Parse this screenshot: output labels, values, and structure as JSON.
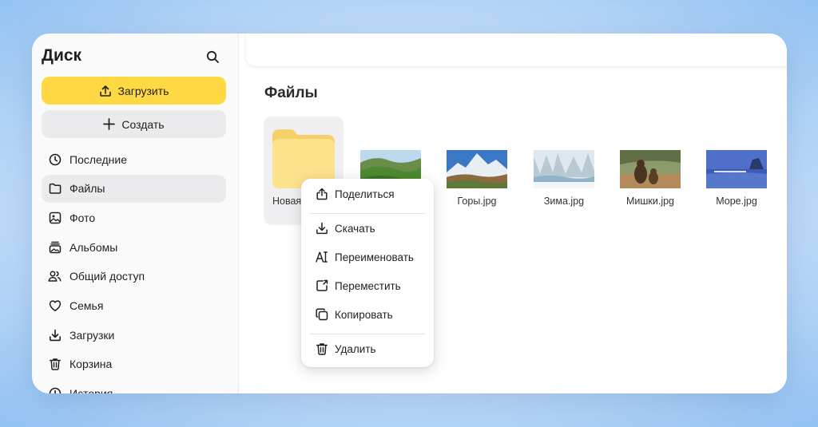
{
  "sidebar": {
    "logo": "Диск",
    "upload_label": "Загрузить",
    "create_label": "Создать",
    "items": [
      {
        "label": "Последние",
        "icon": "clock-icon"
      },
      {
        "label": "Файлы",
        "icon": "folder-icon",
        "active": true
      },
      {
        "label": "Фото",
        "icon": "photo-icon"
      },
      {
        "label": "Альбомы",
        "icon": "albums-icon"
      },
      {
        "label": "Общий доступ",
        "icon": "shared-icon"
      },
      {
        "label": "Семья",
        "icon": "family-heart-icon"
      },
      {
        "label": "Загрузки",
        "icon": "download-icon"
      },
      {
        "label": "Корзина",
        "icon": "trash-icon"
      },
      {
        "label": "История",
        "icon": "history-icon"
      }
    ]
  },
  "main": {
    "title": "Файлы",
    "files": [
      {
        "name": "Новая",
        "type": "folder",
        "selected": true
      },
      {
        "name": "",
        "type": "image",
        "thumb": "green-hills"
      },
      {
        "name": "Горы.jpg",
        "type": "image",
        "thumb": "snowy-mountains"
      },
      {
        "name": "Зима.jpg",
        "type": "image",
        "thumb": "winter-river"
      },
      {
        "name": "Мишки.jpg",
        "type": "image",
        "thumb": "bears"
      },
      {
        "name": "Море.jpg",
        "type": "image",
        "thumb": "sea-pier"
      }
    ]
  },
  "context_menu": {
    "items": [
      {
        "label": "Поделиться",
        "icon": "share-icon"
      },
      {
        "label": "Скачать",
        "icon": "download-icon"
      },
      {
        "label": "Переименовать",
        "icon": "rename-icon"
      },
      {
        "label": "Переместить",
        "icon": "move-icon"
      },
      {
        "label": "Копировать",
        "icon": "copy-icon"
      },
      {
        "label": "Удалить",
        "icon": "trash-icon"
      }
    ]
  },
  "colors": {
    "accent_yellow": "#fed944",
    "active_bg": "#ebebed",
    "folder_yellow": "#fde28c"
  }
}
